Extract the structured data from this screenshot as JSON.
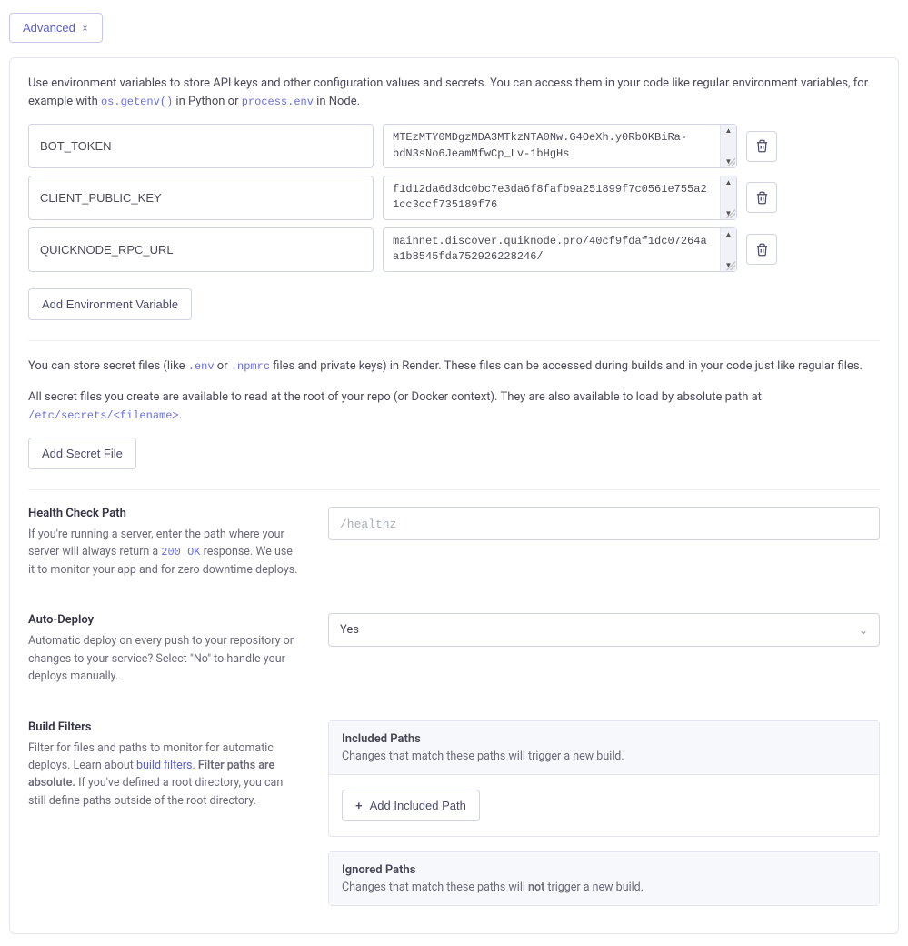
{
  "advanced_toggle_label": "Advanced",
  "env": {
    "intro_prefix": "Use environment variables to store API keys and other configuration values and secrets. You can access them in your code like regular environment variables, for example with ",
    "python_code": "os.getenv()",
    "intro_mid1": " in Python or ",
    "node_code": "process.env",
    "intro_suffix": " in Node.",
    "rows": [
      {
        "key": "BOT_TOKEN",
        "value": "MTEzMTY0MDgzMDA3MTkzNTA0Nw.G4OeXh.y0RbOKBiRa-bdN3sNo6JeamMfwCp_Lv-1bHgHs"
      },
      {
        "key": "CLIENT_PUBLIC_KEY",
        "value": "f1d12da6d3dc0bc7e3da6f8fafb9a251899f7c0561e755a21cc3ccf735189f76"
      },
      {
        "key": "QUICKNODE_RPC_URL",
        "value": "mainnet.discover.quiknode.pro/40cf9fdaf1dc07264aa1b8545fda752926228246/"
      }
    ],
    "add_button": "Add Environment Variable"
  },
  "secrets": {
    "line1_prefix": "You can store secret files (like ",
    "code_env": ".env",
    "line1_or": " or ",
    "code_npmrc": ".npmrc",
    "line1_suffix": " files and private keys) in Render. These files can be accessed during builds and in your code just like regular files.",
    "line2_prefix": "All secret files you create are available to read at the root of your repo (or Docker context). They are also available to load by absolute path at ",
    "path_code": "/etc/secrets/<filename>",
    "line2_suffix": ".",
    "add_button": "Add Secret File"
  },
  "health": {
    "title": "Health Check Path",
    "desc_prefix": "If you're running a server, enter the path where your server will always return a ",
    "code_200": "200 OK",
    "desc_suffix": " response. We use it to monitor your app and for zero downtime deploys.",
    "placeholder": "/healthz"
  },
  "autodeploy": {
    "title": "Auto-Deploy",
    "desc": "Automatic deploy on every push to your repository or changes to your service? Select \"No\" to handle your deploys manually.",
    "value": "Yes"
  },
  "filters": {
    "title": "Build Filters",
    "desc_prefix": "Filter for files and paths to monitor for automatic deploys. Learn about ",
    "link_text": "build filters",
    "desc_mid": ". ",
    "bold_text": "Filter paths are absolute.",
    "desc_suffix": " If you've defined a root directory, you can still define paths outside of the root directory.",
    "included": {
      "title": "Included Paths",
      "desc": "Changes that match these paths will trigger a new build.",
      "add_button": "Add Included Path"
    },
    "ignored": {
      "title": "Ignored Paths",
      "desc_prefix": "Changes that match these paths will ",
      "desc_bold": "not",
      "desc_suffix": " trigger a new build."
    }
  }
}
